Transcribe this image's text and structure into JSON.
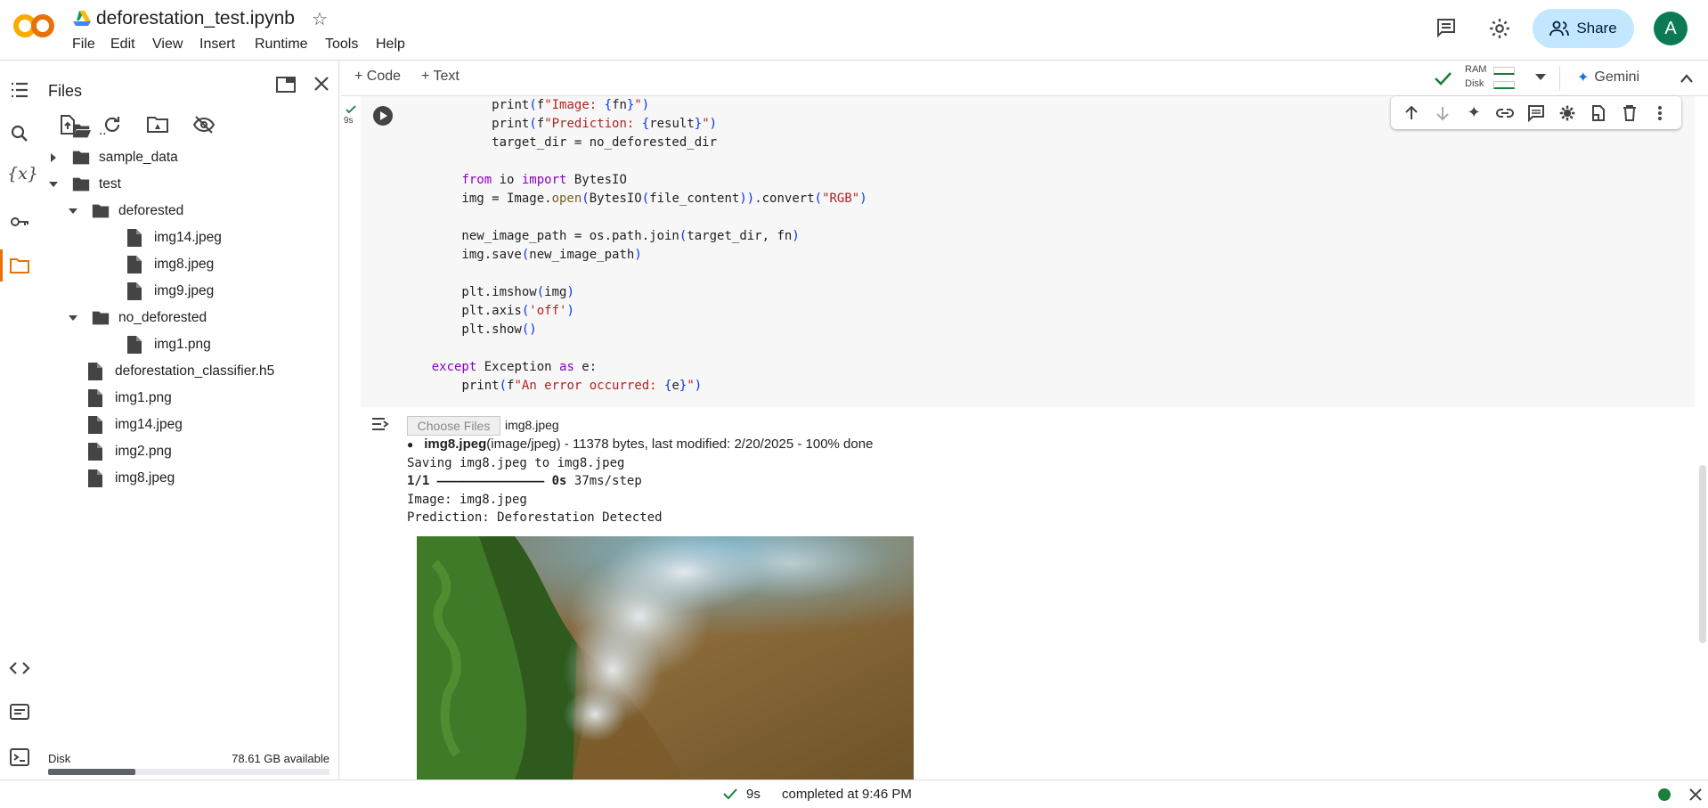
{
  "app": {
    "notebook_title": "deforestation_test.ipynb",
    "menu": [
      "File",
      "Edit",
      "View",
      "Insert",
      "Runtime",
      "Tools",
      "Help"
    ],
    "share_label": "Share",
    "avatar_initial": "A",
    "brand_color": "#f9ab00"
  },
  "toolbar": {
    "add_code": "Code",
    "add_text": "Text",
    "ram_label": "RAM",
    "disk_label": "Disk",
    "gemini_label": "Gemini"
  },
  "files_panel": {
    "title": "Files",
    "items": [
      {
        "label": "..",
        "type": "folder-open",
        "depth": 0
      },
      {
        "label": "sample_data",
        "type": "folder",
        "depth": 0,
        "expanded": false
      },
      {
        "label": "test",
        "type": "folder",
        "depth": 0,
        "expanded": true
      },
      {
        "label": "deforested",
        "type": "folder",
        "depth": 1,
        "expanded": true
      },
      {
        "label": "img14.jpeg",
        "type": "file",
        "depth": 2
      },
      {
        "label": "img8.jpeg",
        "type": "file",
        "depth": 2
      },
      {
        "label": "img9.jpeg",
        "type": "file",
        "depth": 2
      },
      {
        "label": "no_deforested",
        "type": "folder",
        "depth": 1,
        "expanded": true
      },
      {
        "label": "img1.png",
        "type": "file",
        "depth": 2
      },
      {
        "label": "deforestation_classifier.h5",
        "type": "file",
        "depth": 0
      },
      {
        "label": "img1.png",
        "type": "file",
        "depth": 0
      },
      {
        "label": "img14.jpeg",
        "type": "file",
        "depth": 0
      },
      {
        "label": "img2.png",
        "type": "file",
        "depth": 0
      },
      {
        "label": "img8.jpeg",
        "type": "file",
        "depth": 0
      }
    ],
    "disk_label": "Disk",
    "disk_available": "78.61 GB available",
    "disk_used_fraction": 0.31
  },
  "cell": {
    "exec_time": "9s"
  },
  "output": {
    "choose_files": "Choose Files",
    "chosen_file": "img8.jpeg",
    "file_name_bold": "img8.jpeg",
    "file_info": "(image/jpeg) - 11378 bytes, last modified: 2/20/2025 - 100% done",
    "saving_line": "Saving img8.jpeg to img8.jpeg",
    "progress_step": "1/1",
    "progress_bar": "━━━━━━━━━━━━━━━━━━━━",
    "progress_time": "0s",
    "progress_rate": "37ms/step",
    "image_line": "Image: img8.jpeg",
    "prediction_line": "Prediction: Deforestation Detected"
  },
  "statusbar": {
    "duration": "9s",
    "completed": "completed at 9:46 PM"
  }
}
